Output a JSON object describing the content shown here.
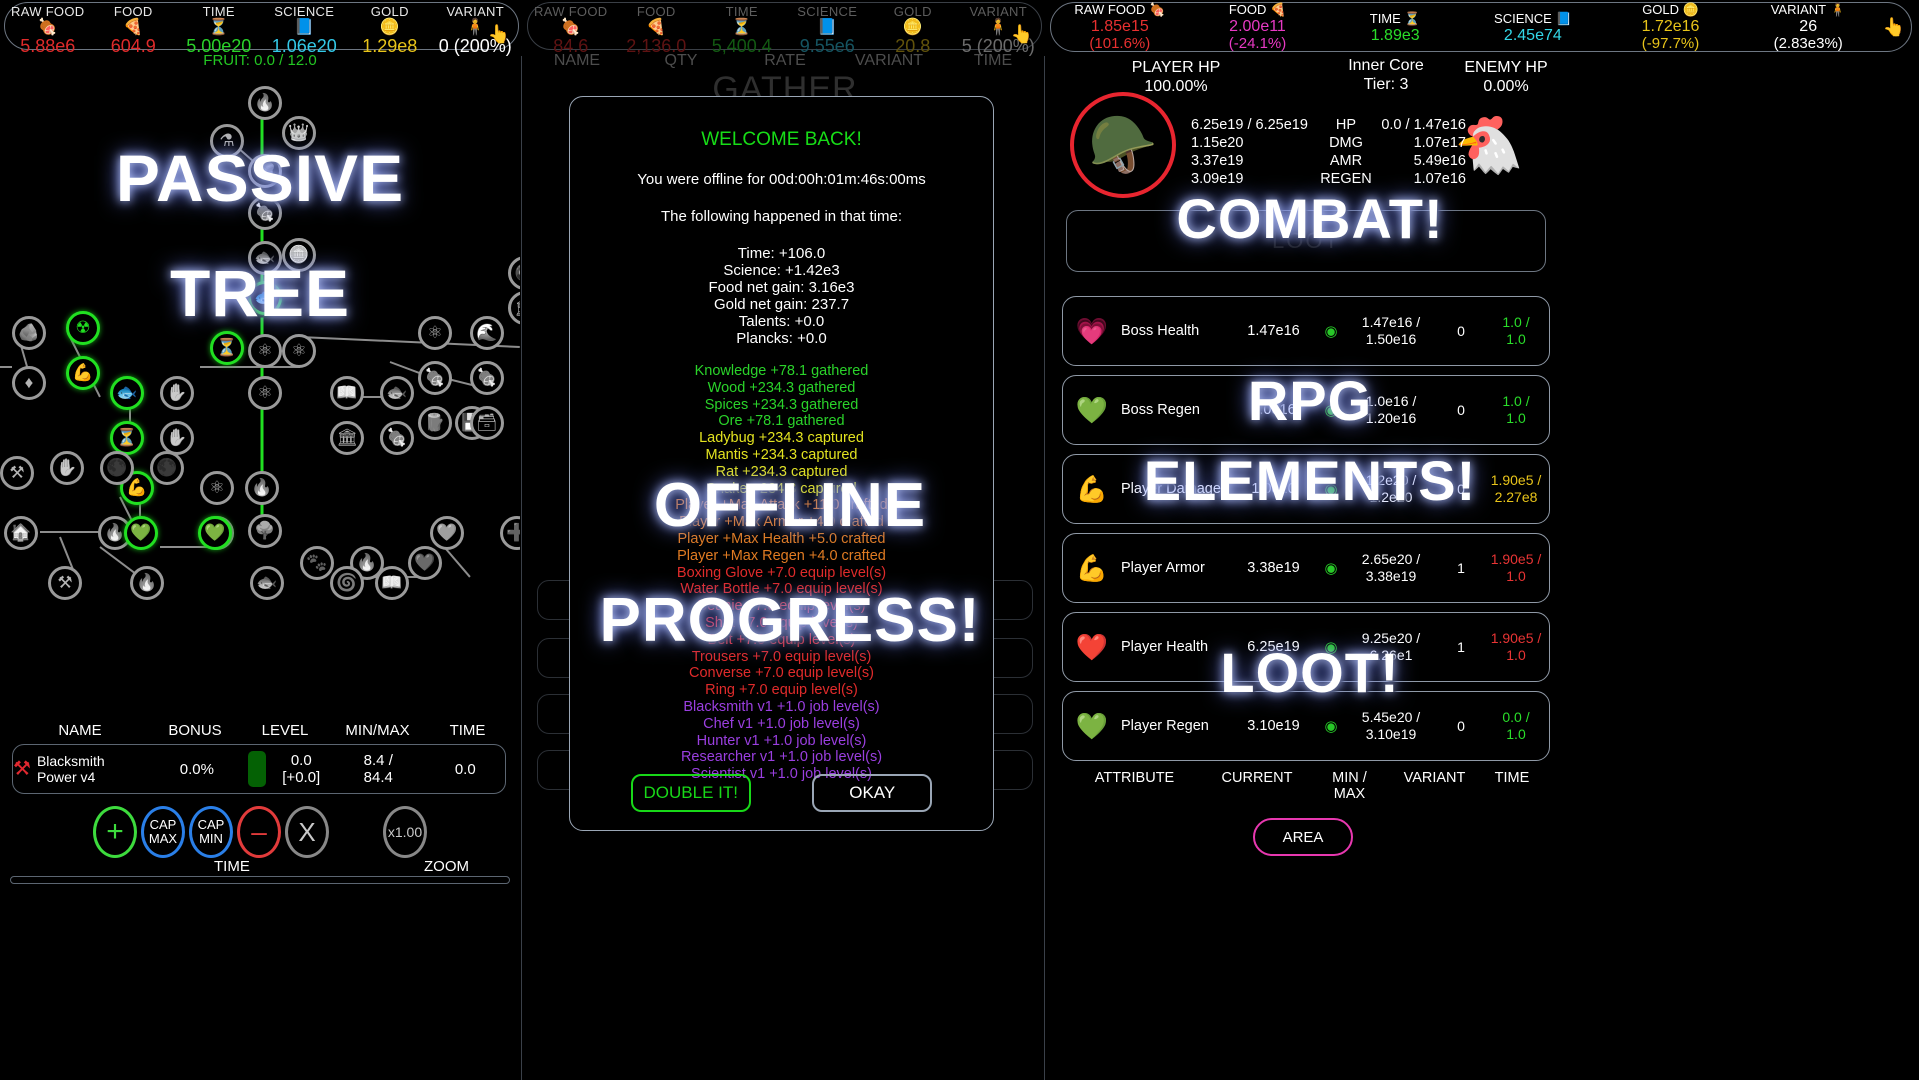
{
  "panel1": {
    "resources": [
      {
        "label": "RAW FOOD",
        "icon": "🍖",
        "value": "5.88e6",
        "color": "#e02b2b"
      },
      {
        "label": "FOOD",
        "icon": "🍕",
        "value": "604.9",
        "color": "#e02b2b"
      },
      {
        "label": "TIME",
        "icon": "⏳",
        "value": "5.00e20",
        "color": "#2ad32a"
      },
      {
        "label": "SCIENCE",
        "icon": "📘",
        "value": "1.06e20",
        "color": "#33c9e8"
      },
      {
        "label": "GOLD",
        "icon": "🪙",
        "value": "1.29e8",
        "color": "#e8c41a"
      },
      {
        "label": "VARIANT",
        "icon": "🧍",
        "value": "0 (200%)",
        "color": "#ffffff"
      }
    ],
    "fruit": "FRUIT: 0.0 / 12.0",
    "overlay_line1": "PASSIVE",
    "overlay_line2": "TREE",
    "table_headers": [
      "NAME",
      "BONUS",
      "LEVEL",
      "MIN/MAX",
      "TIME"
    ],
    "job": {
      "name_line1": "Blacksmith",
      "name_line2": "Power v4",
      "bonus": "0.0%",
      "level": "0.0",
      "level_delta": "[+0.0]",
      "minmax_line1": "8.4 /",
      "minmax_line2": "84.4",
      "time": "0.0"
    },
    "controls": [
      {
        "name": "plus",
        "label": "+"
      },
      {
        "name": "cap-max",
        "label1": "CAP",
        "label2": "MAX"
      },
      {
        "name": "cap-min",
        "label1": "CAP",
        "label2": "MIN"
      },
      {
        "name": "minus",
        "label": "–"
      },
      {
        "name": "clear",
        "label": "X"
      },
      {
        "name": "zoom",
        "label": "x1.00"
      }
    ],
    "ctl_label_time": "TIME",
    "ctl_label_zoom": "ZOOM"
  },
  "panel2": {
    "resources": [
      {
        "label": "RAW FOOD",
        "icon": "🍖",
        "value": "84.6",
        "color": "#e02b2b"
      },
      {
        "label": "FOOD",
        "icon": "🍕",
        "value": "2,136.0",
        "color": "#e02b2b"
      },
      {
        "label": "TIME",
        "icon": "⏳",
        "value": "5,400.4",
        "color": "#2ad32a"
      },
      {
        "label": "SCIENCE",
        "icon": "📘",
        "value": "9.55e6",
        "color": "#33c9e8"
      },
      {
        "label": "GOLD",
        "icon": "🪙",
        "value": "20.8",
        "color": "#e8c41a"
      },
      {
        "label": "VARIANT",
        "icon": "🧍",
        "value": "5 (200%)",
        "color": "#ffffff"
      }
    ],
    "table_headers": [
      "NAME",
      "QTY",
      "RATE",
      "VARIANT",
      "TIME"
    ],
    "title": "GATHER"
  },
  "panel3": {
    "resources": [
      {
        "label": "RAW FOOD",
        "icon": "🍖",
        "v1": "1.85e15",
        "v2": "(101.6%)",
        "color": "#e83030"
      },
      {
        "label": "FOOD",
        "icon": "🍕",
        "v1": "2.00e11",
        "v2": "(-24.1%)",
        "color": "#e83ac4"
      },
      {
        "label": "TIME",
        "icon": "⏳",
        "v1": "1.89e3",
        "v2": "",
        "color": "#2ade2a"
      },
      {
        "label": "SCIENCE",
        "icon": "📘",
        "v1": "2.45e74",
        "v2": "",
        "color": "#33d8e8"
      },
      {
        "label": "GOLD",
        "icon": "🪙",
        "v1": "1.72e16",
        "v2": "(-97.7%)",
        "color": "#e8c41a"
      },
      {
        "label": "VARIANT",
        "icon": "🧍",
        "v1": "26",
        "v2": "(2.83e3%)",
        "color": "#ffffff"
      }
    ],
    "player_hp_label": "PLAYER HP",
    "player_hp_value": "100.00%",
    "enemy_hp_label": "ENEMY HP",
    "enemy_hp_value": "0.00%",
    "zone_name": "Inner Core",
    "zone_tier": "Tier: 3",
    "stat_rows": [
      {
        "player": "6.25e19 / 6.25e19",
        "label": "HP",
        "enemy": "0.0 / 1.47e16"
      },
      {
        "player": "1.15e20",
        "label": "DMG",
        "enemy": "1.07e17"
      },
      {
        "player": "3.37e19",
        "label": "AMR",
        "enemy": "5.49e16"
      },
      {
        "player": "3.09e19",
        "label": "REGEN",
        "enemy": "1.07e16"
      }
    ],
    "loot_title": "LOOT",
    "overlay_line1": "COMBAT!",
    "overlay_line2": "RPG",
    "overlay_line3": "ELEMENTS!",
    "overlay_line4": "LOOT!",
    "attributes": [
      {
        "icon": "💗",
        "icon_color": "#ff2fae",
        "name": "Boss Health",
        "current": "1.47e16",
        "minmax_line1": "1.47e16 /",
        "minmax_line2": "1.50e16",
        "variant": "0",
        "time_line1": "1.0 /",
        "time_line2": "1.0",
        "time_color": "#2ade2a"
      },
      {
        "icon": "💚",
        "icon_color": "#c7f028",
        "name": "Boss Regen",
        "current": "1.0e16",
        "minmax_line1": "1.0e16 /",
        "minmax_line2": "1.20e16",
        "variant": "0",
        "time_line1": "1.0 /",
        "time_line2": "1.0",
        "time_color": "#2ade2a"
      },
      {
        "icon": "💪",
        "icon_color": "#e8c41a",
        "name": "Player Damage",
        "current": "1.0e20",
        "minmax_line1": "1.2e20 /",
        "minmax_line2": "1.2e20",
        "variant": "0",
        "time_line1": "1.90e5 /",
        "time_line2": "2.27e8",
        "time_color": "#e8c41a"
      },
      {
        "icon": "💪",
        "icon_color": "#2f7fe8",
        "name": "Player Armor",
        "current": "3.38e19",
        "minmax_line1": "2.65e20 /",
        "minmax_line2": "3.38e19",
        "variant": "1",
        "time_line1": "1.90e5 /",
        "time_line2": "1.0",
        "time_color": "#e83434"
      },
      {
        "icon": "❤️",
        "icon_color": "#e02b3c",
        "name": "Player Health",
        "current": "6.25e19",
        "minmax_line1": "9.25e20 /",
        "minmax_line2": "6.26e1",
        "variant": "1",
        "time_line1": "1.90e5 /",
        "time_line2": "1.0",
        "time_color": "#e83434"
      },
      {
        "icon": "💚",
        "icon_color": "#3ddb3d",
        "name": "Player Regen",
        "current": "3.10e19",
        "minmax_line1": "5.45e20 /",
        "minmax_line2": "3.10e19",
        "variant": "0",
        "time_line1": "0.0 /",
        "time_line2": "1.0",
        "time_color": "#2ade2a"
      }
    ],
    "attr_headers": [
      "ATTRIBUTE",
      "CURRENT",
      "MIN /\nMAX",
      "VARIANT",
      "TIME"
    ],
    "area_button": "AREA"
  },
  "modal": {
    "title": "WELCOME BACK!",
    "offline_line": "You were offline for 00d:00h:01m:46s:00ms",
    "intro": "The following happened in that time:",
    "summary": [
      "Time: +106.0",
      "Science: +1.42e3",
      "Food net gain: 3.16e3",
      "Gold net gain: 237.7",
      "Talents: +0.0",
      "Plancks: +0.0"
    ],
    "gathers": [
      {
        "text": "Knowledge +78.1 gathered",
        "cls": "g1"
      },
      {
        "text": "Wood +234.3 gathered",
        "cls": "g1"
      },
      {
        "text": "Spices +234.3 gathered",
        "cls": "g1"
      },
      {
        "text": "Ore +78.1 gathered",
        "cls": "g1"
      },
      {
        "text": "Ladybug +234.3 captured",
        "cls": "y1"
      },
      {
        "text": "Mantis +234.3 captured",
        "cls": "y1"
      },
      {
        "text": "Rat +234.3 captured",
        "cls": "y1"
      },
      {
        "text": "Snake +234.3 captured",
        "cls": "y1"
      },
      {
        "text": "Player +Max Attack +11.0 crafted",
        "cls": "o1"
      },
      {
        "text": "Player +Max Armor +4.0 crafted",
        "cls": "o1"
      },
      {
        "text": "Player +Max Health +5.0 crafted",
        "cls": "o1"
      },
      {
        "text": "Player +Max Regen +4.0 crafted",
        "cls": "o1"
      },
      {
        "text": "Boxing Glove +7.0 equip level(s)",
        "cls": "r1"
      },
      {
        "text": "Water Bottle +7.0 equip level(s)",
        "cls": "r1"
      },
      {
        "text": "Beanie +7.0 equip level(s)",
        "cls": "r1"
      },
      {
        "text": "Shirt +7.0 equip level(s)",
        "cls": "r1"
      },
      {
        "text": "Belt +7.0 equip level(s)",
        "cls": "r1"
      },
      {
        "text": "Trousers +7.0 equip level(s)",
        "cls": "r1"
      },
      {
        "text": "Converse +7.0 equip level(s)",
        "cls": "r1"
      },
      {
        "text": "Ring +7.0 equip level(s)",
        "cls": "r1"
      },
      {
        "text": "Blacksmith v1 +1.0 job level(s)",
        "cls": "p1"
      },
      {
        "text": "Chef v1 +1.0 job level(s)",
        "cls": "p1"
      },
      {
        "text": "Hunter v1 +1.0 job level(s)",
        "cls": "p1"
      },
      {
        "text": "Researcher v1 +1.0 job level(s)",
        "cls": "p1"
      },
      {
        "text": "Scientist v1 +1.0 job level(s)",
        "cls": "p1"
      }
    ],
    "double_button": "DOUBLE IT!",
    "okay_button": "OKAY"
  }
}
